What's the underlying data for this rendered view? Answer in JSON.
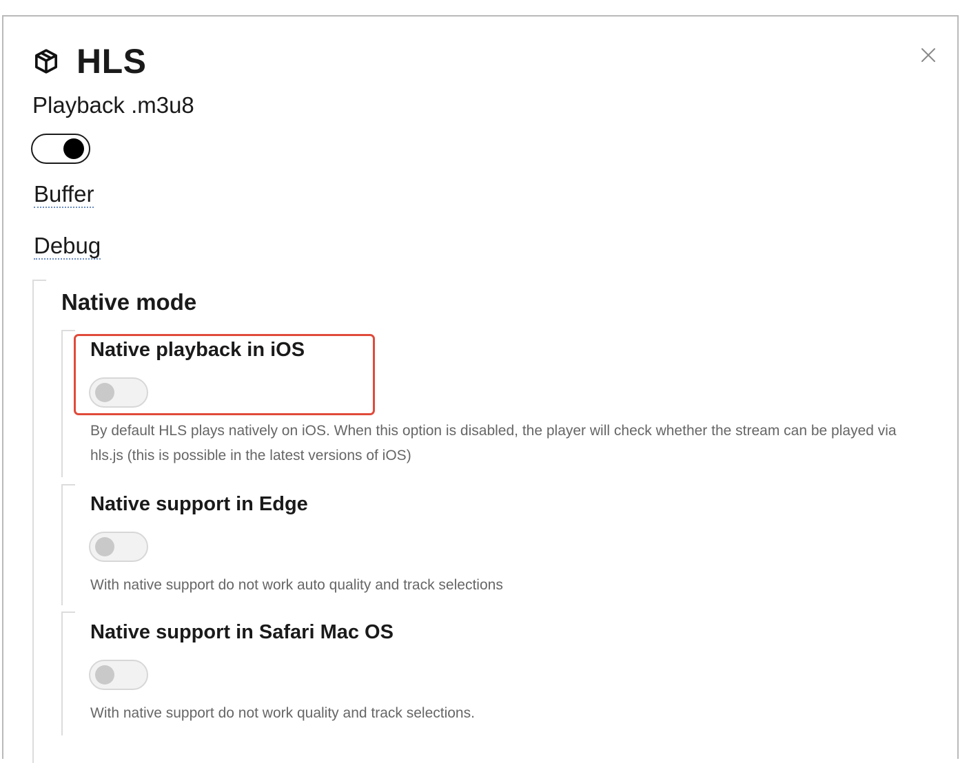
{
  "dialog": {
    "title": "HLS",
    "subtitle": "Playback .m3u8",
    "icons": {
      "title_icon": "cube-icon",
      "close_icon": "close-icon"
    },
    "enabled": true
  },
  "links": {
    "buffer": "Buffer",
    "debug": "Debug"
  },
  "native_mode": {
    "title": "Native mode",
    "options": [
      {
        "title": "Native playback in iOS",
        "enabled": false,
        "description": "By default HLS plays natively on iOS. When this option is disabled, the player will check whether the stream can be played via hls.js (this is possible in the latest versions of iOS)"
      },
      {
        "title": "Native support in Edge",
        "enabled": false,
        "description": "With native support do not work auto quality and track selections"
      },
      {
        "title": "Native support in Safari Mac OS",
        "enabled": false,
        "description": "With native support do not work quality and track selections."
      }
    ]
  },
  "colors": {
    "highlight": "#e04a3a",
    "link_underline": "#6a8cc0"
  }
}
